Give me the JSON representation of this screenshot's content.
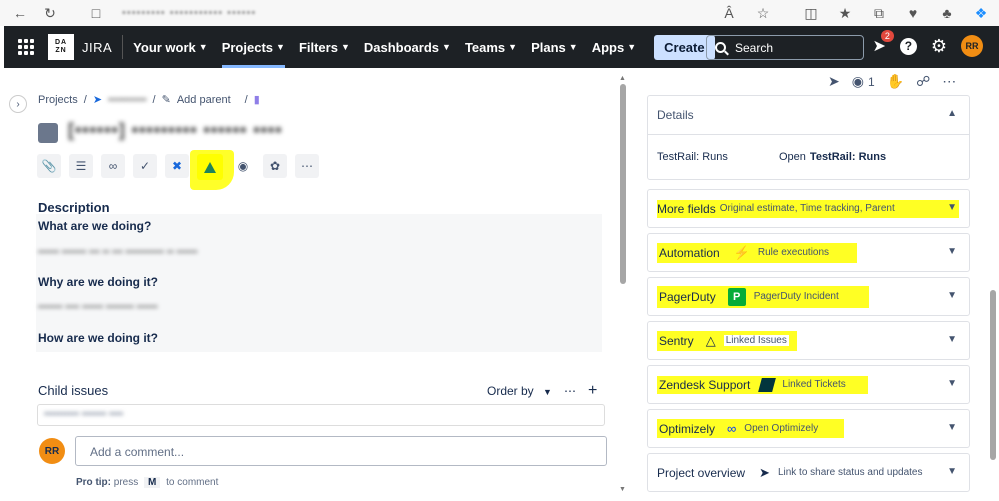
{
  "browser": {
    "url_blurred": "••••••••• ••••••••••• ••••••",
    "icons": [
      "back-icon",
      "refresh-icon",
      "lock-icon",
      "read-aloud-icon",
      "star-icon",
      "split-icon",
      "favorites-icon",
      "collections-icon",
      "performance-icon",
      "extensions-icon",
      "copilot-icon"
    ]
  },
  "nav": {
    "brand_top": "DA",
    "brand_bottom": "ZN",
    "product": "JIRA",
    "items": [
      "Your work",
      "Projects",
      "Filters",
      "Dashboards",
      "Teams",
      "Plans",
      "Apps"
    ],
    "active_item": "Projects",
    "create": "Create",
    "search_placeholder": "Search",
    "notification_count": "2",
    "help": "?",
    "avatar_initials": "RR"
  },
  "issue": {
    "breadcrumb_projects": "Projects",
    "breadcrumb_blur1": "••••••••••",
    "add_parent": "Add parent",
    "title_blurred": "[••••••] ••••••••• •••••• ••••",
    "toolbar_icons": [
      "attach-icon",
      "child-issue-icon",
      "link-icon",
      "broom-icon",
      "confluence-icon",
      "pendo-icon",
      "target-icon",
      "blossom-icon",
      "more-icon"
    ],
    "description_label": "Description",
    "sections": [
      {
        "heading": "What are we doing?",
        "body_blurred": "•••••• ••••••• ••• •• ••• ••••••••••• •• ••••••"
      },
      {
        "heading": "Why are we doing it?",
        "body_blurred": "••••••• •••• •••••• •••••••• ••••••"
      },
      {
        "heading": "How are we doing it?",
        "body_blurred": ""
      }
    ],
    "child_issues_label": "Child issues",
    "order_by": "Order by",
    "child_row_blurred": "•••••••••• ••••••• ••••",
    "comment_avatar": "RR",
    "comment_placeholder": "Add a comment...",
    "protip_label": "Pro tip:",
    "protip_press": "press",
    "protip_key": "M",
    "protip_suffix": "to comment"
  },
  "side": {
    "watch_count": "1",
    "details": {
      "label": "Details",
      "testrail_label": "TestRail: Runs",
      "testrail_open": "Open",
      "testrail_link": "TestRail: Runs"
    },
    "panels": [
      {
        "title": "More fields",
        "subtitle": "Original estimate, Time tracking, Parent",
        "icon": "",
        "highlight": true
      },
      {
        "title": "Automation",
        "subtitle": "Rule executions",
        "icon": "lightning-icon",
        "highlight": true
      },
      {
        "title": "PagerDuty",
        "subtitle": "PagerDuty Incident",
        "icon": "pagerduty-icon",
        "highlight": true
      },
      {
        "title": "Sentry",
        "subtitle": "Linked Issues",
        "icon": "sentry-icon",
        "highlight": true
      },
      {
        "title": "Zendesk Support",
        "subtitle": "Linked Tickets",
        "icon": "zendesk-icon",
        "highlight": true
      },
      {
        "title": "Optimizely",
        "subtitle": "Open Optimizely",
        "icon": "optimizely-icon",
        "highlight": true
      },
      {
        "title": "Project overview",
        "subtitle": "Link to share status and updates",
        "icon": "megaphone-icon",
        "highlight": false
      }
    ],
    "pagerduty_letter": "P"
  }
}
